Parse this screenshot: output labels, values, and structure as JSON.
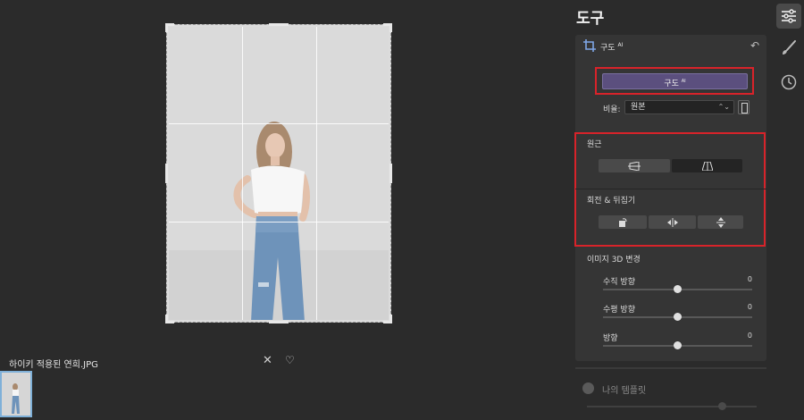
{
  "canvas": {
    "filename": "하이키 적용된 연희.JPG",
    "close_glyph": "✕",
    "heart_glyph": "♡"
  },
  "panel": {
    "title": "도구",
    "section": {
      "label": "구도",
      "label_badge": "AI",
      "compose_button": "구도",
      "compose_badge": "AI",
      "ratio_label": "비율:",
      "ratio_value": "원본",
      "perspective_label": "원근",
      "rotate_label": "회전 & 뒤집기",
      "transform3d_label": "이미지 3D 변경",
      "sliders": [
        {
          "label": "수직 방향",
          "value": "0",
          "level": 0.5
        },
        {
          "label": "수평 방향",
          "value": "0",
          "level": 0.5
        },
        {
          "label": "방향",
          "value": "0",
          "level": 0.5
        }
      ]
    },
    "templates_label": "나의 템플릿"
  },
  "toolbar": {
    "items": [
      "adjust-icon",
      "brush-icon",
      "history-icon"
    ],
    "active": "adjust-icon"
  },
  "colors": {
    "accent": "#5b4f7e",
    "highlight": "#d8232a",
    "background": "#2b2b2b",
    "panel": "#353535"
  }
}
